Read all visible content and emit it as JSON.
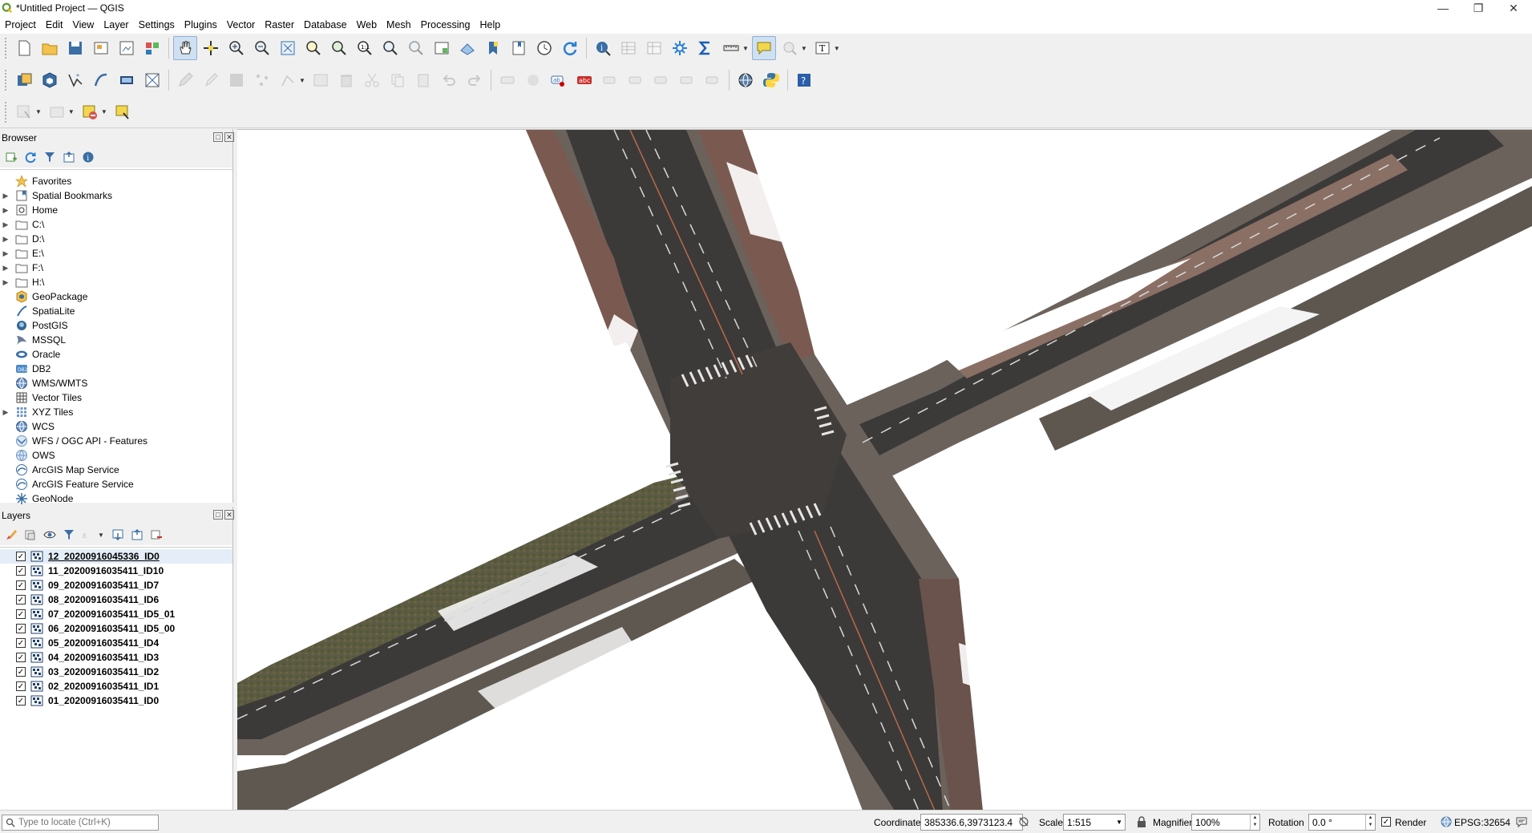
{
  "window": {
    "title": "*Untitled Project — QGIS",
    "app_icon": "qgis-logo-icon",
    "controls": [
      "minimize",
      "maximize",
      "close"
    ]
  },
  "menu": [
    "Project",
    "Edit",
    "View",
    "Layer",
    "Settings",
    "Plugins",
    "Vector",
    "Raster",
    "Database",
    "Web",
    "Mesh",
    "Processing",
    "Help"
  ],
  "browser": {
    "title": "Browser",
    "items": [
      {
        "label": "Favorites",
        "icon": "star-icon",
        "expandable": false
      },
      {
        "label": "Spatial Bookmarks",
        "icon": "bookmark-icon",
        "expandable": true
      },
      {
        "label": "Home",
        "icon": "home-folder-icon",
        "expandable": true
      },
      {
        "label": "C:\\",
        "icon": "folder-icon",
        "expandable": true
      },
      {
        "label": "D:\\",
        "icon": "folder-icon",
        "expandable": true
      },
      {
        "label": "E:\\",
        "icon": "folder-icon",
        "expandable": true
      },
      {
        "label": "F:\\",
        "icon": "folder-icon",
        "expandable": true
      },
      {
        "label": "H:\\",
        "icon": "folder-icon",
        "expandable": true
      },
      {
        "label": "GeoPackage",
        "icon": "geopackage-icon",
        "expandable": false
      },
      {
        "label": "SpatiaLite",
        "icon": "spatialite-icon",
        "expandable": false
      },
      {
        "label": "PostGIS",
        "icon": "postgis-icon",
        "expandable": false
      },
      {
        "label": "MSSQL",
        "icon": "mssql-icon",
        "expandable": false
      },
      {
        "label": "Oracle",
        "icon": "oracle-icon",
        "expandable": false
      },
      {
        "label": "DB2",
        "icon": "db2-icon",
        "expandable": false
      },
      {
        "label": "WMS/WMTS",
        "icon": "globe-icon",
        "expandable": false
      },
      {
        "label": "Vector Tiles",
        "icon": "grid-icon",
        "expandable": false
      },
      {
        "label": "XYZ Tiles",
        "icon": "xyz-tiles-icon",
        "expandable": true
      },
      {
        "label": "WCS",
        "icon": "globe-icon",
        "expandable": false
      },
      {
        "label": "WFS / OGC API - Features",
        "icon": "wfs-icon",
        "expandable": false
      },
      {
        "label": "OWS",
        "icon": "globe-outline-icon",
        "expandable": false
      },
      {
        "label": "ArcGIS Map Service",
        "icon": "arcgis-icon",
        "expandable": false
      },
      {
        "label": "ArcGIS Feature Service",
        "icon": "arcgis-icon",
        "expandable": false
      },
      {
        "label": "GeoNode",
        "icon": "geonode-icon",
        "expandable": false
      }
    ]
  },
  "layers": {
    "title": "Layers",
    "items": [
      {
        "label": "12_20200916045336_ID0",
        "checked": true,
        "selected": true
      },
      {
        "label": "11_20200916035411_ID10",
        "checked": true,
        "selected": false
      },
      {
        "label": "09_20200916035411_ID7",
        "checked": true,
        "selected": false
      },
      {
        "label": "08_20200916035411_ID6",
        "checked": true,
        "selected": false
      },
      {
        "label": "07_20200916035411_ID5_01",
        "checked": true,
        "selected": false
      },
      {
        "label": "06_20200916035411_ID5_00",
        "checked": true,
        "selected": false
      },
      {
        "label": "05_20200916035411_ID4",
        "checked": true,
        "selected": false
      },
      {
        "label": "04_20200916035411_ID3",
        "checked": true,
        "selected": false
      },
      {
        "label": "03_20200916035411_ID2",
        "checked": true,
        "selected": false
      },
      {
        "label": "02_20200916035411_ID1",
        "checked": true,
        "selected": false
      },
      {
        "label": "01_20200916035411_ID0",
        "checked": true,
        "selected": false
      }
    ]
  },
  "status": {
    "locator_placeholder": "Type to locate (Ctrl+K)",
    "coordinate_label": "Coordinate",
    "coordinate_value": "385336.6,3973123.4",
    "scale_label": "Scale",
    "scale_value": "1:515",
    "magnifier_label": "Magnifier",
    "magnifier_value": "100%",
    "rotation_label": "Rotation",
    "rotation_value": "0.0 °",
    "render_label": "Render",
    "render_checked": true,
    "crs": "EPSG:32654"
  },
  "colors": {
    "road": "#3c3a38",
    "sidewalk": "#6b625c",
    "vegetation": "#4e5330",
    "roof_brown": "#7a5a50",
    "selection_blue": "#cfe0f1"
  }
}
